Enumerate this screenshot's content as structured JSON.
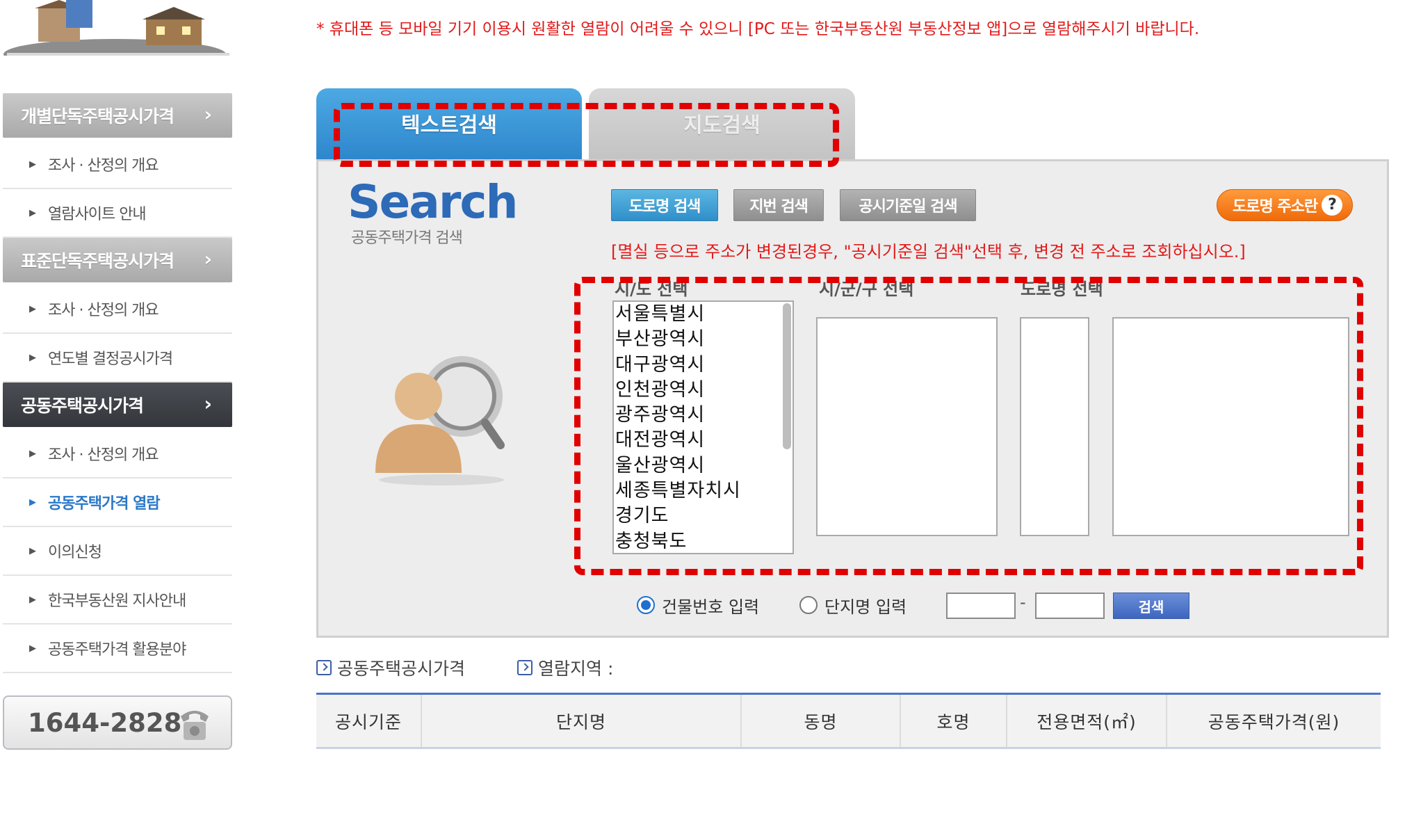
{
  "notice": "* 휴대폰 등 모바일 기기 이용시 원활한 열람이 어려울 수 있으니 [PC 또는 한국부동산원 부동산정보 앱]으로 열람해주시기 바랍니다.",
  "sidebar": {
    "categories": [
      {
        "label": "개별단독주택공시가격"
      },
      {
        "label": "표준단독주택공시가격"
      },
      {
        "label": "공동주택공시가격"
      }
    ],
    "items": [
      {
        "label": "조사 · 산정의 개요"
      },
      {
        "label": "열람사이트 안내"
      },
      {
        "label": "조사 · 산정의 개요"
      },
      {
        "label": "연도별 결정공시가격"
      },
      {
        "label": "조사 · 산정의 개요"
      },
      {
        "label": "공동주택가격 열람"
      },
      {
        "label": "이의신청"
      },
      {
        "label": "한국부동산원 지사안내"
      },
      {
        "label": "공동주택가격 활용분야"
      }
    ],
    "phone": "1644-2828"
  },
  "tabs": {
    "text_search": "텍스트검색",
    "map_search": "지도검색"
  },
  "search": {
    "logo": "Search",
    "subtitle": "공동주택가격 검색",
    "buttons": {
      "road": "도로명 검색",
      "lot": "지번 검색",
      "date": "공시기준일 검색",
      "road_addr": "도로명 주소란"
    },
    "warning": "[멸실 등으로 주소가 변경된경우, \"공시기준일 검색\"선택 후, 변경 전 주소로 조회하십시오.]",
    "labels": {
      "sido": "시/도 선택",
      "sigungu": "시/군/구 선택",
      "road": "도로명 선택"
    },
    "sido_options": [
      "서울특별시",
      "부산광역시",
      "대구광역시",
      "인천광역시",
      "광주광역시",
      "대전광역시",
      "울산광역시",
      "세종특별자치시",
      "경기도",
      "충청북도"
    ],
    "radio_building": "건물번호 입력",
    "radio_complex": "단지명 입력",
    "dash": "-",
    "go": "검색"
  },
  "results": {
    "label1": "공동주택공시가격",
    "label2": "열람지역 :",
    "columns": [
      "공시기준",
      "단지명",
      "동명",
      "호명",
      "전용면적(㎡)",
      "공동주택가격(원)"
    ]
  },
  "colors": {
    "accent_blue": "#2d86cc",
    "warning_red": "#e21a1a",
    "highlight_red": "#e00000",
    "orange": "#ef6a0a"
  }
}
